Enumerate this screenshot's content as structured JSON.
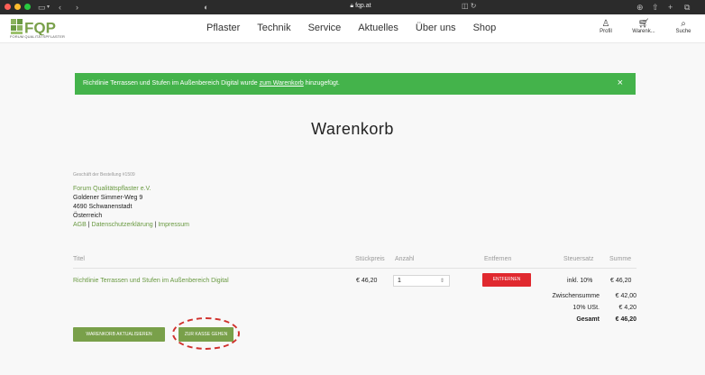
{
  "browser": {
    "url": "fqp.at",
    "controls": [
      "‹",
      "›"
    ],
    "icons": [
      "shield-icon",
      "sidebar-icon",
      "lock-icon",
      "download-icon",
      "share-icon",
      "plus-icon",
      "tabs-icon"
    ]
  },
  "header": {
    "logo_text": "FQP",
    "logo_subtitle": "FORUM QUALITÄTSPFLASTER",
    "nav": [
      "Pflaster",
      "Technik",
      "Service",
      "Aktuelles",
      "Über uns",
      "Shop"
    ],
    "icons": [
      {
        "name": "profile",
        "label": "Profil"
      },
      {
        "name": "cart",
        "label": "Warenk..."
      },
      {
        "name": "search",
        "label": "Suche"
      }
    ]
  },
  "notice": {
    "before": "Richtlinie Terrassen und Stufen im Außenbereich Digital wurde ",
    "link": "zum Warenkorb",
    "after": " hinzugefügt.",
    "close": "×"
  },
  "page_title": "Warenkorb",
  "seller": {
    "order_label": "Geschäft der Bestellung #1509",
    "name": "Forum Qualitätspflaster e.V.",
    "street": "Goldener Simmer-Weg 9",
    "city": "4690 Schwanenstadt",
    "country": "Österreich",
    "links": [
      "AGB",
      "Datenschutzerklärung",
      "Impressum"
    ],
    "separator": "|"
  },
  "table": {
    "headers": {
      "title": "Titel",
      "unit_price": "Stückpreis",
      "quantity": "Anzahl",
      "remove": "Entfernen",
      "tax": "Steuersatz",
      "sum": "Summe"
    },
    "row": {
      "title": "Richtlinie Terrassen und Stufen im Außenbereich Digital",
      "unit_price": "€ 46,20",
      "quantity": "1",
      "remove_label": "ENTFERNEN",
      "tax": "inkl. 10%",
      "sum": "€ 46,20"
    },
    "totals": {
      "subtotal_label": "Zwischensumme",
      "subtotal": "€ 42,00",
      "vat_label": "10% USt.",
      "vat": "€ 4,20",
      "total_label": "Gesamt",
      "total": "€ 46,20"
    }
  },
  "buttons": {
    "update": "WARENKORB AKTUALISIEREN",
    "checkout": "ZUR KASSE GEHEN"
  },
  "colors": {
    "brand_green": "#79a04a",
    "notice_green": "#44b34b",
    "remove_red": "#e0292f",
    "highlight_red": "#d0312d"
  }
}
